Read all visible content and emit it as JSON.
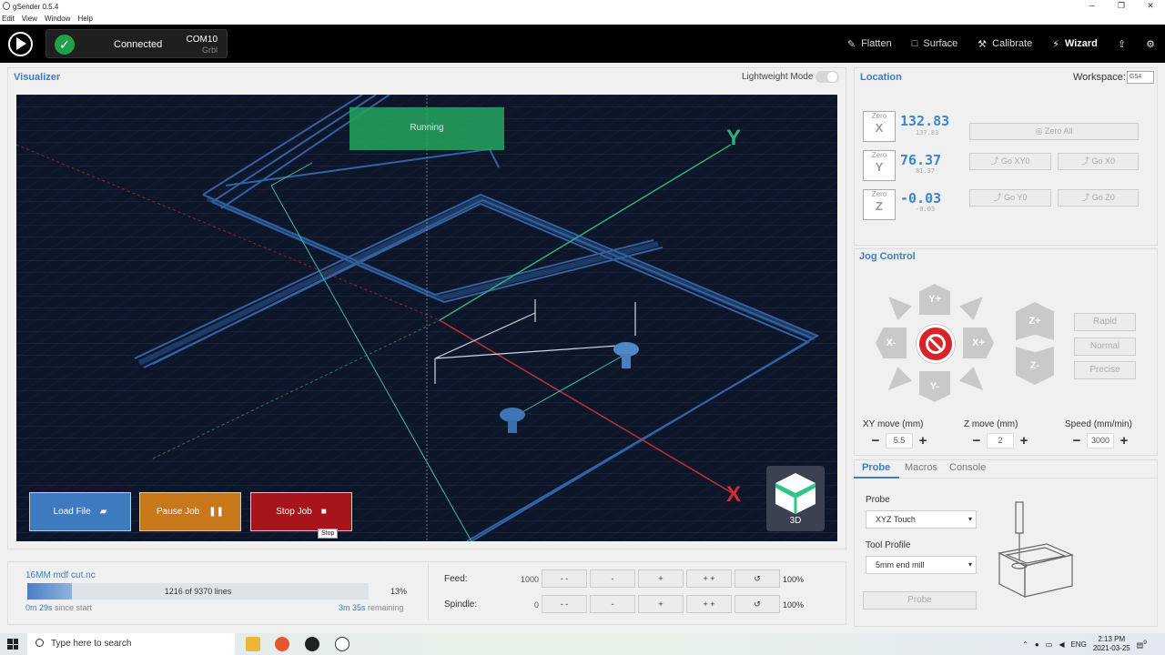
{
  "window": {
    "title": "gSender 0.5.4",
    "controls": [
      "─",
      "❐",
      "✕"
    ]
  },
  "menu": [
    "Edit",
    "View",
    "Window",
    "Help"
  ],
  "header": {
    "status": "Connected",
    "port": "COM10",
    "firmware": "Grbl",
    "nav": [
      {
        "label": "Flatten",
        "icon": "flatten-icon",
        "bold": false
      },
      {
        "label": "Surface",
        "icon": "surface-icon",
        "bold": false
      },
      {
        "label": "Calibrate",
        "icon": "wrench-icon",
        "bold": false
      },
      {
        "label": "Wizard",
        "icon": "wand-icon",
        "bold": true
      }
    ]
  },
  "visualizer": {
    "title": "Visualizer",
    "lightweight_label": "Lightweight Mode",
    "lightweight_on": false,
    "status": "Running",
    "buttons": {
      "load": "Load File",
      "pause": "Pause Job",
      "stop": "Stop Job"
    },
    "tooltip": "Stop",
    "view_label": "3D",
    "axis_x": "X",
    "axis_y": "Y",
    "colors": {
      "load": "#3d7abf",
      "pause": "#c8771b",
      "stop": "#a8141c",
      "bg": "#0d1529"
    }
  },
  "location": {
    "title": "Location",
    "workspace_label": "Workspace:",
    "workspace_value": "G54",
    "zero_label": "Zero",
    "axes": [
      {
        "axis": "X",
        "value": "132.83",
        "machine": "137.83"
      },
      {
        "axis": "Y",
        "value": "76.37",
        "machine": "81.37"
      },
      {
        "axis": "Z",
        "value": "-0.03",
        "machine": "-0.03"
      }
    ],
    "buttons": {
      "zero_all": "Zero All",
      "go_xy0": "Go XY0",
      "go_x0": "Go X0",
      "go_y0": "Go Y0",
      "go_z0": "Go Z0"
    }
  },
  "jog": {
    "title": "Jog Control",
    "yplus": "Y+",
    "yminus": "Y-",
    "xplus": "X+",
    "xminus": "X-",
    "zplus": "Z+",
    "zminus": "Z-",
    "modes": [
      "Rapid",
      "Normal",
      "Precise"
    ],
    "xy_label": "XY move (mm)",
    "xy_value": "5.5",
    "z_label": "Z move (mm)",
    "z_value": "2",
    "speed_label": "Speed (mm/min)",
    "speed_value": "3000"
  },
  "probe": {
    "tabs": [
      "Probe",
      "Macros",
      "Console"
    ],
    "probe_label": "Probe",
    "probe_value": "XYZ Touch",
    "tool_label": "Tool Profile",
    "tool_value": "5mm end mill",
    "button": "Probe"
  },
  "job": {
    "filename": "16MM mdf cut.nc",
    "progress_fraction": 0.13,
    "lines_text": "1216 of 9370 lines",
    "percent": "13%",
    "elapsed": "0m 29s",
    "elapsed_suffix": " since start",
    "remaining": "3m 35s",
    "remaining_suffix": " remaining"
  },
  "overrides": {
    "feed_label": "Feed:",
    "feed_value": "1000",
    "feed_pct": "100%",
    "spindle_label": "Spindle:",
    "spindle_value": "0",
    "spindle_pct": "100%",
    "buttons": [
      "- -",
      "-",
      "+",
      "+ +"
    ]
  },
  "taskbar": {
    "search_placeholder": "Type here to search",
    "lang": "ENG",
    "time": "2:13 PM",
    "date": "2021-03-25",
    "notif": "9"
  }
}
